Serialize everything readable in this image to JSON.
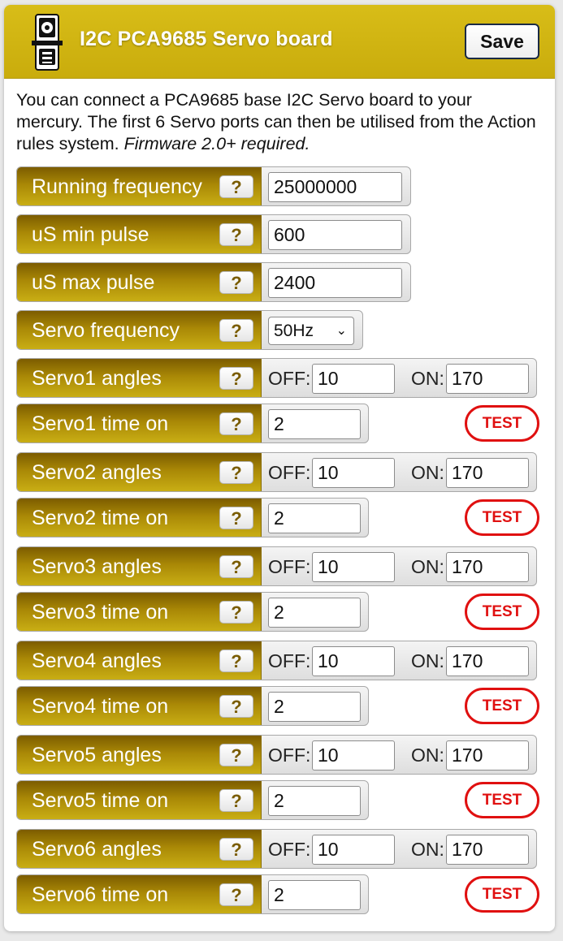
{
  "header": {
    "title": "I2C PCA9685 Servo board",
    "save_label": "Save",
    "icon": "servo-board-logo"
  },
  "description": {
    "text": "You can connect a PCA9685 base I2C Servo board to your mercury. The first 6 Servo ports can then be utilised from the Action rules system. ",
    "note": "Firmware 2.0+ required."
  },
  "help_glyph": "?",
  "settings": {
    "running_frequency": {
      "label": "Running frequency",
      "value": "25000000"
    },
    "us_min_pulse": {
      "label": "uS min pulse",
      "value": "600"
    },
    "us_max_pulse": {
      "label": "uS max pulse",
      "value": "2400"
    },
    "servo_frequency": {
      "label": "Servo frequency",
      "value": "50Hz",
      "chevron": "⌄"
    }
  },
  "servo_prefix": {
    "off": "OFF:",
    "on": "ON:"
  },
  "test_label": "TEST",
  "servos": [
    {
      "angles_label": "Servo1 angles",
      "off": "10",
      "on": "170",
      "time_label": "Servo1 time on",
      "time": "2"
    },
    {
      "angles_label": "Servo2 angles",
      "off": "10",
      "on": "170",
      "time_label": "Servo2 time on",
      "time": "2"
    },
    {
      "angles_label": "Servo3 angles",
      "off": "10",
      "on": "170",
      "time_label": "Servo3 time on",
      "time": "2"
    },
    {
      "angles_label": "Servo4 angles",
      "off": "10",
      "on": "170",
      "time_label": "Servo4 time on",
      "time": "2"
    },
    {
      "angles_label": "Servo5 angles",
      "off": "10",
      "on": "170",
      "time_label": "Servo5 time on",
      "time": "2"
    },
    {
      "angles_label": "Servo6 angles",
      "off": "10",
      "on": "170",
      "time_label": "Servo6 time on",
      "time": "2"
    }
  ],
  "colors": {
    "header_gold": "#d0b412",
    "label_gold": "#a98806",
    "test_red": "#e01010"
  }
}
